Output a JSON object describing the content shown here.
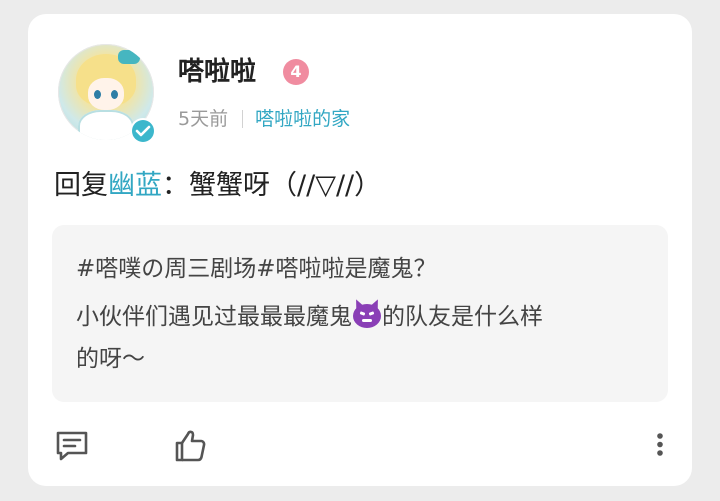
{
  "post": {
    "username": "嗒啦啦",
    "level": "4",
    "time_ago": "5天前",
    "home_link": "嗒啦啦的家",
    "reply_prefix": "回复",
    "reply_to": "幽蓝",
    "reply_colon": "：",
    "reply_text": "蟹蟹呀（//▽//）"
  },
  "quoted": {
    "line1": "#嗒噗の周三剧场#嗒啦啦是魔鬼？",
    "line2_before": "小伙伴们遇见过最最最魔鬼",
    "emoji": "angry-devil-emoji",
    "line2_after": "的队友是什么样",
    "line3": "的呀～"
  },
  "actions": {
    "comment_icon": "comment-icon",
    "like_icon": "thumbs-up-icon",
    "more_icon": "more-vertical-icon"
  },
  "colors": {
    "accent": "#32a7c3",
    "level_badge": "#f08ca0",
    "verified": "#3cb7cc"
  }
}
